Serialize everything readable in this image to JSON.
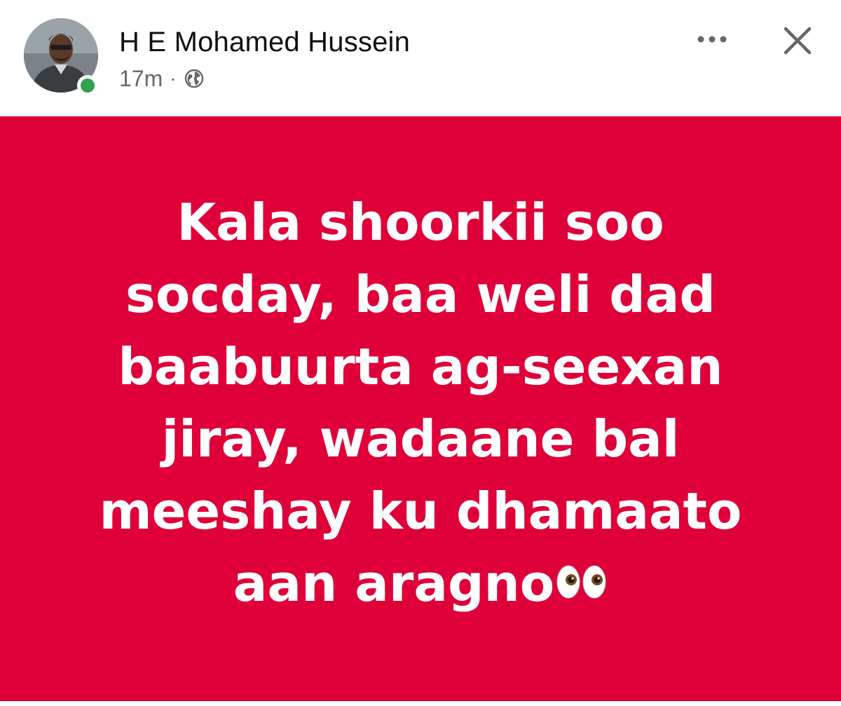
{
  "post": {
    "author": "H E Mohamed Hussein",
    "timestamp": "17m",
    "separator": "·",
    "audience_icon": "globe-icon",
    "online": true,
    "actions": {
      "more_icon": "more-horizontal-icon",
      "close_icon": "close-icon"
    },
    "background_color": "#df003a",
    "text_lines": [
      "Kala shoorkii soo",
      "socday, baa weli dad",
      "baabuurta ag-seexan",
      "jiray, wadaane bal",
      "meeshay ku dhamaato",
      "aan aragno"
    ],
    "trailing_emoji": "eyes-icon"
  }
}
